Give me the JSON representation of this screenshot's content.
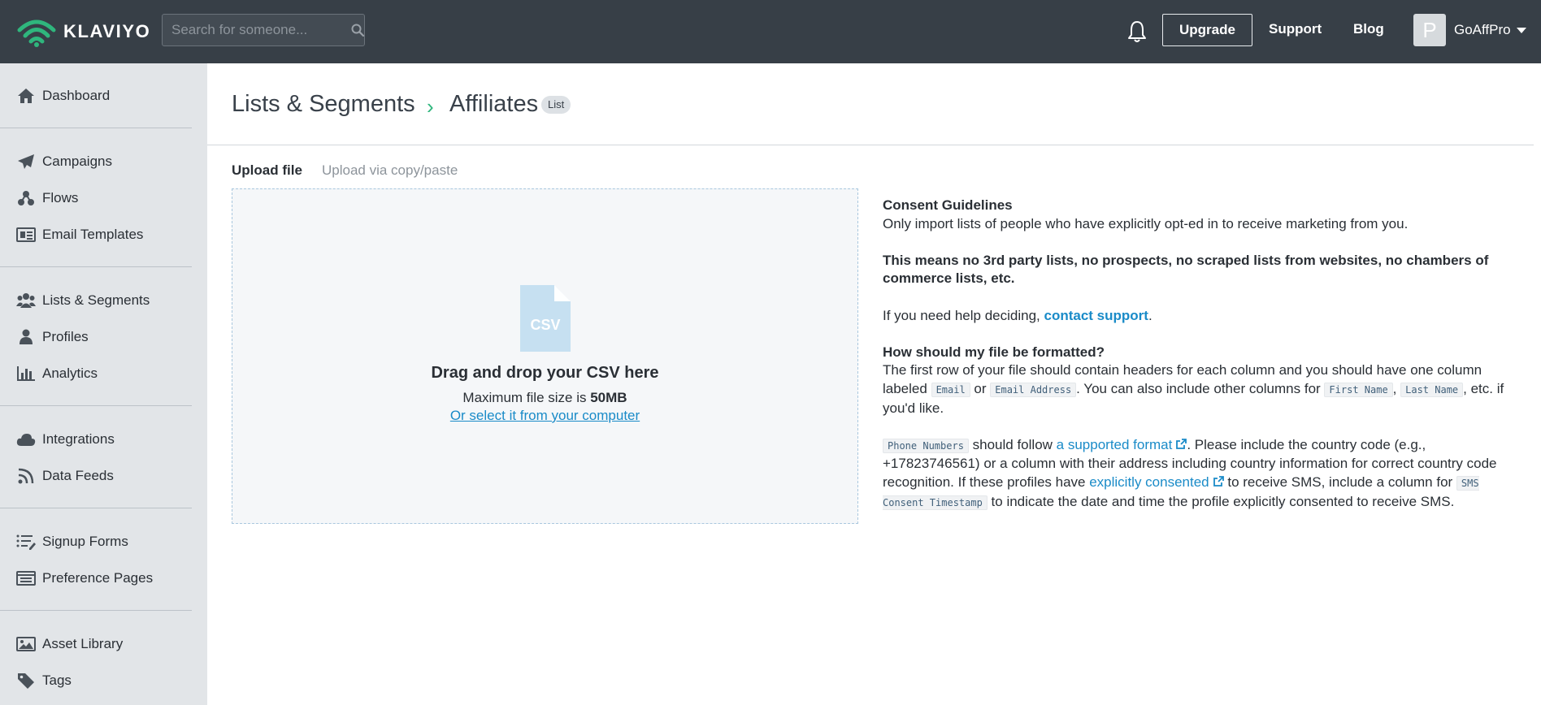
{
  "brand": {
    "name": "KLAVIYO"
  },
  "colors": {
    "topbar": "#373f47",
    "sidebar": "#e2e5e8",
    "accent_green": "#2fb67d",
    "link": "#1a8bc8"
  },
  "search": {
    "placeholder": "Search for someone..."
  },
  "header": {
    "upgrade_label": "Upgrade",
    "support_label": "Support",
    "blog_label": "Blog",
    "avatar_initial": "P",
    "account_name": "GoAffPro"
  },
  "sidebar": {
    "items": [
      {
        "label": "Dashboard",
        "icon": "home-icon"
      },
      {
        "label": "Campaigns",
        "icon": "paper-plane-icon"
      },
      {
        "label": "Flows",
        "icon": "flows-icon"
      },
      {
        "label": "Email Templates",
        "icon": "newspaper-icon"
      },
      {
        "label": "Lists & Segments",
        "icon": "users-icon"
      },
      {
        "label": "Profiles",
        "icon": "user-icon"
      },
      {
        "label": "Analytics",
        "icon": "bar-chart-icon"
      },
      {
        "label": "Integrations",
        "icon": "cloud-icon"
      },
      {
        "label": "Data Feeds",
        "icon": "rss-icon"
      },
      {
        "label": "Signup Forms",
        "icon": "form-list-icon"
      },
      {
        "label": "Preference Pages",
        "icon": "preference-icon"
      },
      {
        "label": "Asset Library",
        "icon": "image-icon"
      },
      {
        "label": "Tags",
        "icon": "tag-icon"
      }
    ]
  },
  "breadcrumb": {
    "parent": "Lists & Segments",
    "separator": "›",
    "current": "Affiliates",
    "badge": "List"
  },
  "tabs": {
    "upload_file": "Upload file",
    "copy_paste": "Upload via copy/paste"
  },
  "dropzone": {
    "icon_text": "CSV",
    "title": "Drag and drop your CSV here",
    "size_prefix": "Maximum file size is ",
    "size_value": "50MB",
    "select_link": "Or select it from your computer"
  },
  "guidelines": {
    "consent_title": "Consent Guidelines",
    "consent_text": "Only import lists of people who have explicitly opt-ed in to receive marketing from you.",
    "warning_text": "This means no 3rd party lists, no prospects, no scraped lists from websites, no chambers of commerce lists, etc.",
    "help_prefix": "If you need help deciding, ",
    "help_link": "contact support",
    "help_suffix": ".",
    "format_title": "How should my file be formatted?",
    "format_text_1": "The first row of your file should contain headers for each column and you should have one column labeled ",
    "code_email": "Email",
    "or_text": " or ",
    "code_email_address": "Email Address",
    "format_text_2": ". You can also include other columns for ",
    "code_first_name": "First Name",
    "comma": ", ",
    "code_last_name": "Last Name",
    "format_text_3": ", etc. if you'd like.",
    "code_phone": "Phone Numbers",
    "phone_text_1": " should follow ",
    "supported_format_link": "a supported format",
    "phone_text_2": ".   Please include the country code (e.g., +17823746561) or a column with their address including country information for correct country code recognition. If these profiles have ",
    "consented_link": "explicitly consented",
    "phone_text_3": "  to receive SMS, include a column for ",
    "code_sms": "SMS Consent Timestamp",
    "phone_text_4": " to indicate the date and time the profile explicitly consented to receive SMS."
  }
}
